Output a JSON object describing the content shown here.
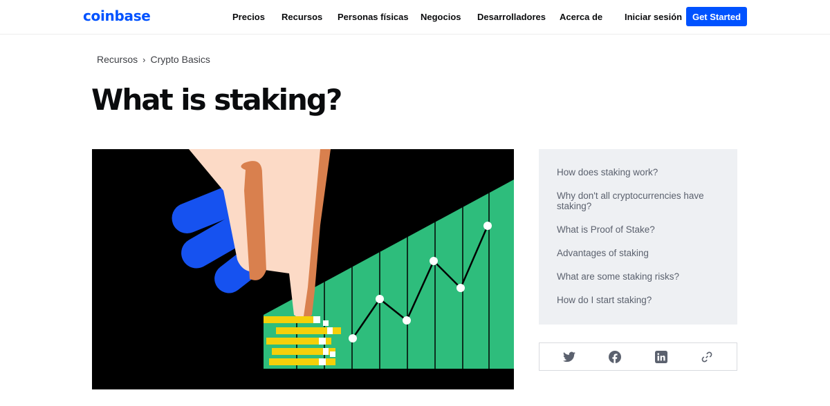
{
  "header": {
    "logo": "coinbase",
    "nav": [
      "Precios",
      "Recursos",
      "Personas físicas",
      "Negocios",
      "Desarrolladores",
      "Acerca de"
    ],
    "sign_in": "Iniciar sesión",
    "cta": "Get Started"
  },
  "breadcrumb": {
    "parent": "Recursos",
    "separator": "›",
    "current": "Crypto Basics"
  },
  "page_title": "What is staking?",
  "toc": [
    "How does staking work?",
    "Why don't all cryptocurrencies have staking?",
    "What is Proof of Stake?",
    "Advantages of staking",
    "What are some staking risks?",
    "How do I start staking?"
  ],
  "share": [
    "twitter-icon",
    "facebook-icon",
    "linkedin-icon",
    "link-icon"
  ],
  "colors": {
    "brand": "#0052ff",
    "hero_background": "#000000",
    "hero_green": "#2ebd7c",
    "coin_yellow": "#f5d00a",
    "hand_skin": "#fcdac6",
    "hand_shadow": "#d9804e",
    "hand_blue": "#1652f0"
  }
}
